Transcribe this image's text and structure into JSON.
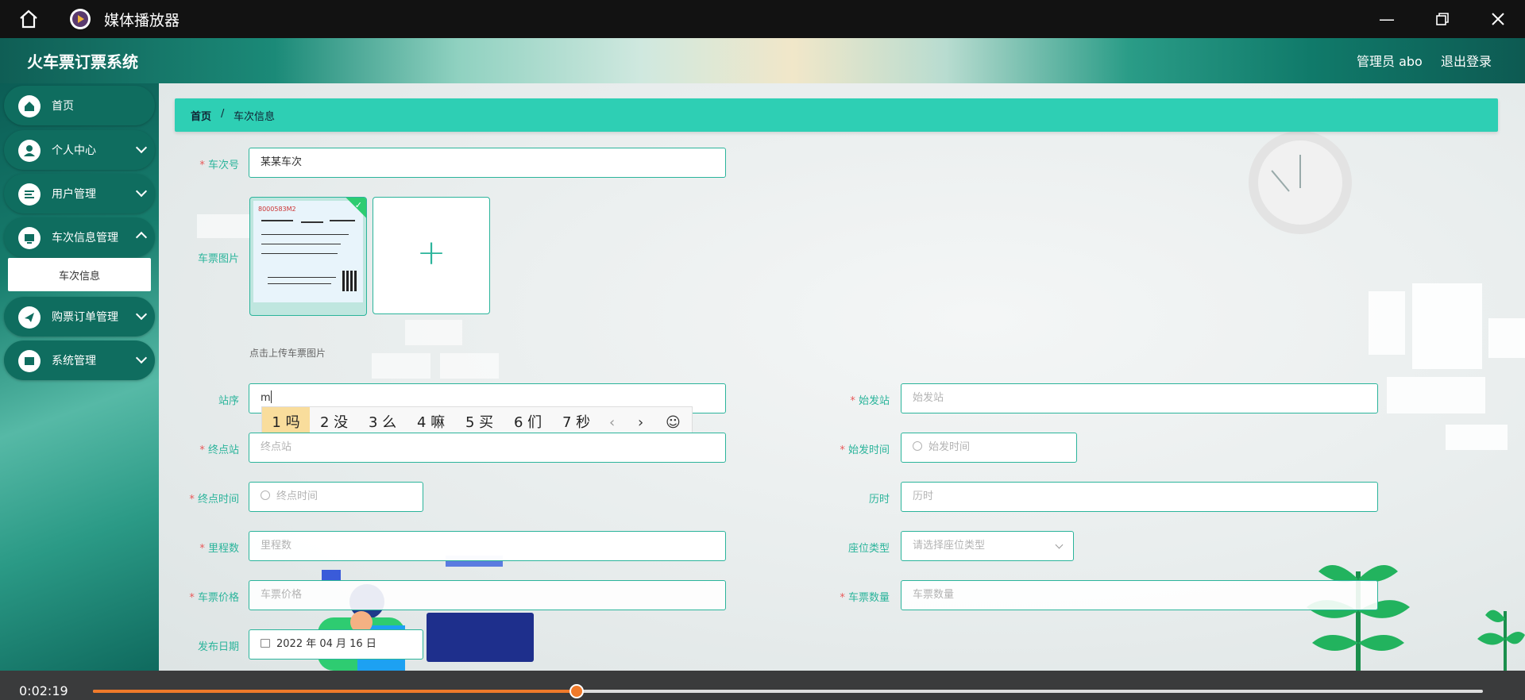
{
  "player": {
    "title": "媒体播放器",
    "icons": {
      "home": "home-icon",
      "app": "play-icon",
      "minimize": "minimize-icon",
      "restore": "restore-icon",
      "close": "close-icon"
    },
    "current_time": "0:02:19",
    "progress": 0.348
  },
  "header": {
    "brand": "火车票订票系统",
    "admin": "管理员 abo",
    "logout": "退出登录"
  },
  "sidebar": {
    "items": [
      {
        "label": "首页",
        "icon": "home-icon"
      },
      {
        "label": "个人中心",
        "icon": "person-icon"
      },
      {
        "label": "用户管理",
        "icon": "list-icon"
      },
      {
        "label": "车次信息管理",
        "icon": "monitor-icon"
      },
      {
        "label": "购票订单管理",
        "icon": "send-icon"
      },
      {
        "label": "系统管理",
        "icon": "box-icon"
      }
    ],
    "sub_item": "车次信息"
  },
  "breadcrumb": {
    "home": "首页",
    "sep": "/",
    "current": "车次信息"
  },
  "form": {
    "train_no": {
      "label": "车次号",
      "value": "某某车次"
    },
    "ticket_image": {
      "label": "车票图片",
      "hint": "点击上传车票图片",
      "ticket_text": "8000583M2",
      "upload_icon": "+"
    },
    "station_order": {
      "label": "站序",
      "value": "m"
    },
    "start_station": {
      "label": "始发站",
      "placeholder": "始发站"
    },
    "end_station": {
      "label": "终点站",
      "placeholder": "终点站"
    },
    "start_time": {
      "label": "始发时间",
      "placeholder": "始发时间"
    },
    "end_time": {
      "label": "终点时间",
      "placeholder": "终点时间"
    },
    "duration": {
      "label": "历时",
      "placeholder": "历时"
    },
    "mileage": {
      "label": "里程数",
      "placeholder": "里程数"
    },
    "seat_type": {
      "label": "座位类型",
      "placeholder": "请选择座位类型"
    },
    "price": {
      "label": "车票价格",
      "placeholder": "车票价格"
    },
    "quantity": {
      "label": "车票数量",
      "placeholder": "车票数量"
    },
    "publish_date": {
      "label": "发布日期",
      "value": "2022 年 04 月 16 日"
    }
  },
  "ime": {
    "candidates": [
      "1 吗",
      "2 没",
      "3 么",
      "4 嘛",
      "5 买",
      "6 们",
      "7 秒"
    ],
    "prev": "‹",
    "next": "›",
    "emoji": "☺"
  },
  "colors": {
    "accent": "#2bb49b",
    "breadcrumb": "#2ecfb4",
    "required": "#e85a5a",
    "progress": "#f07a2a"
  }
}
